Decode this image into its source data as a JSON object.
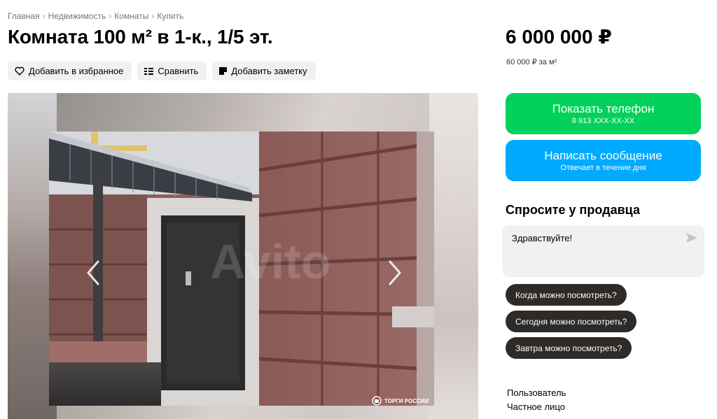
{
  "breadcrumb": [
    "Главная",
    "Недвижимость",
    "Комнаты",
    "Купить"
  ],
  "breadcrumb_separator": "›",
  "title": "Комната 100 м² в 1-к., 1/5 эт.",
  "actions": {
    "favorite": "Добавить в избранное",
    "compare": "Сравнить",
    "note": "Добавить заметку"
  },
  "gallery": {
    "watermark": "Avito",
    "photo_logo": "ТОРГИ РОССИИ"
  },
  "price": {
    "total": "6 000 000 ₽",
    "per_m2": "60 000 ₽ за м²"
  },
  "contact": {
    "show_phone": "Показать телефон",
    "phone_masked": "8 913 XXX-XX-XX",
    "write_message": "Написать сообщение",
    "reply_time": "Отвечает в течение дня"
  },
  "ask": {
    "title": "Спросите у продавца",
    "message_value": "Здравствуйте!",
    "quick_questions": [
      "Когда можно посмотреть?",
      "Сегодня можно посмотреть?",
      "Завтра можно посмотреть?"
    ]
  },
  "seller": {
    "name": "Пользователь",
    "type": "Частное лицо"
  },
  "colors": {
    "phone_button": "#02d15c",
    "message_button": "#00aaff",
    "chip_bg": "#f2f1f0",
    "quick_bg": "#2d2a28"
  }
}
